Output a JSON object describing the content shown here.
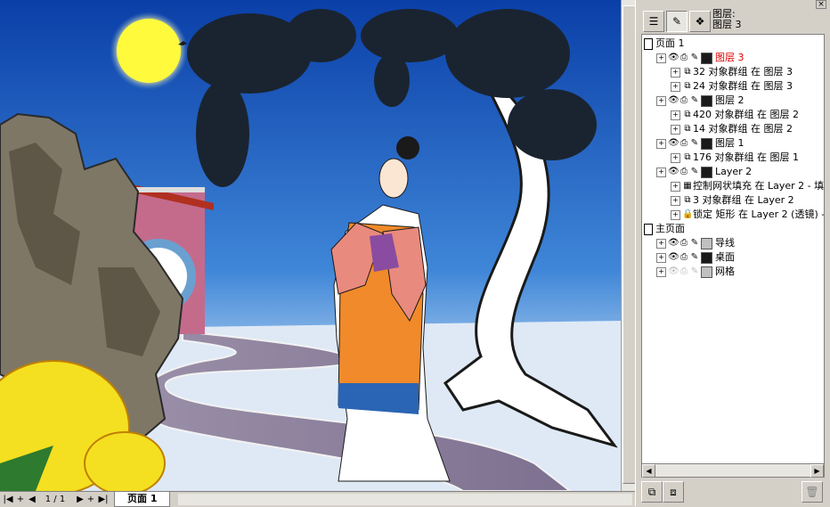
{
  "bottom_bar": {
    "nav_first": "|◀",
    "nav_add": "+",
    "nav_prev": "◀",
    "page_counter": "1 / 1",
    "nav_next": "▶",
    "nav_add2": "+",
    "nav_last": "▶|",
    "page_tab": "页面 1"
  },
  "panel": {
    "current_layer_label_1": "图层:",
    "current_layer_label_2": "图层 3",
    "close": "×"
  },
  "tree": [
    {
      "label": "页面 1",
      "level": 0,
      "kind": "page"
    },
    {
      "label": "图层 3",
      "level": 1,
      "kind": "layer",
      "swatch": "#1a1a1a",
      "color": "#e00000"
    },
    {
      "label": "32 对象群组 在 图层 3",
      "level": 2,
      "kind": "group"
    },
    {
      "label": "24 对象群组 在 图层 3",
      "level": 2,
      "kind": "group"
    },
    {
      "label": "图层 2",
      "level": 1,
      "kind": "layer",
      "swatch": "#1a1a1a"
    },
    {
      "label": "420 对象群组 在 图层 2",
      "level": 2,
      "kind": "group"
    },
    {
      "label": "14 对象群组 在 图层 2",
      "level": 2,
      "kind": "group"
    },
    {
      "label": "图层 1",
      "level": 1,
      "kind": "layer",
      "swatch": "#1a1a1a"
    },
    {
      "label": "176 对象群组 在 图层 1",
      "level": 2,
      "kind": "group"
    },
    {
      "label": "Layer 2",
      "level": 1,
      "kind": "layer",
      "swatch": "#1a1a1a"
    },
    {
      "label": "控制网状填充 在 Layer 2 - 填",
      "level": 2,
      "kind": "mesh"
    },
    {
      "label": "3 对象群组 在 Layer 2",
      "level": 2,
      "kind": "group"
    },
    {
      "label": "锁定 矩形 在 Layer 2 (透镜) -",
      "level": 2,
      "kind": "locked"
    },
    {
      "label": "主页面",
      "level": 0,
      "kind": "page"
    },
    {
      "label": "导线",
      "level": 1,
      "kind": "master",
      "swatch": "#c0c0c0"
    },
    {
      "label": "桌面",
      "level": 1,
      "kind": "master",
      "swatch": "#1a1a1a"
    },
    {
      "label": "网格",
      "level": 1,
      "kind": "master-dim",
      "swatch": "#c0c0c0"
    }
  ]
}
